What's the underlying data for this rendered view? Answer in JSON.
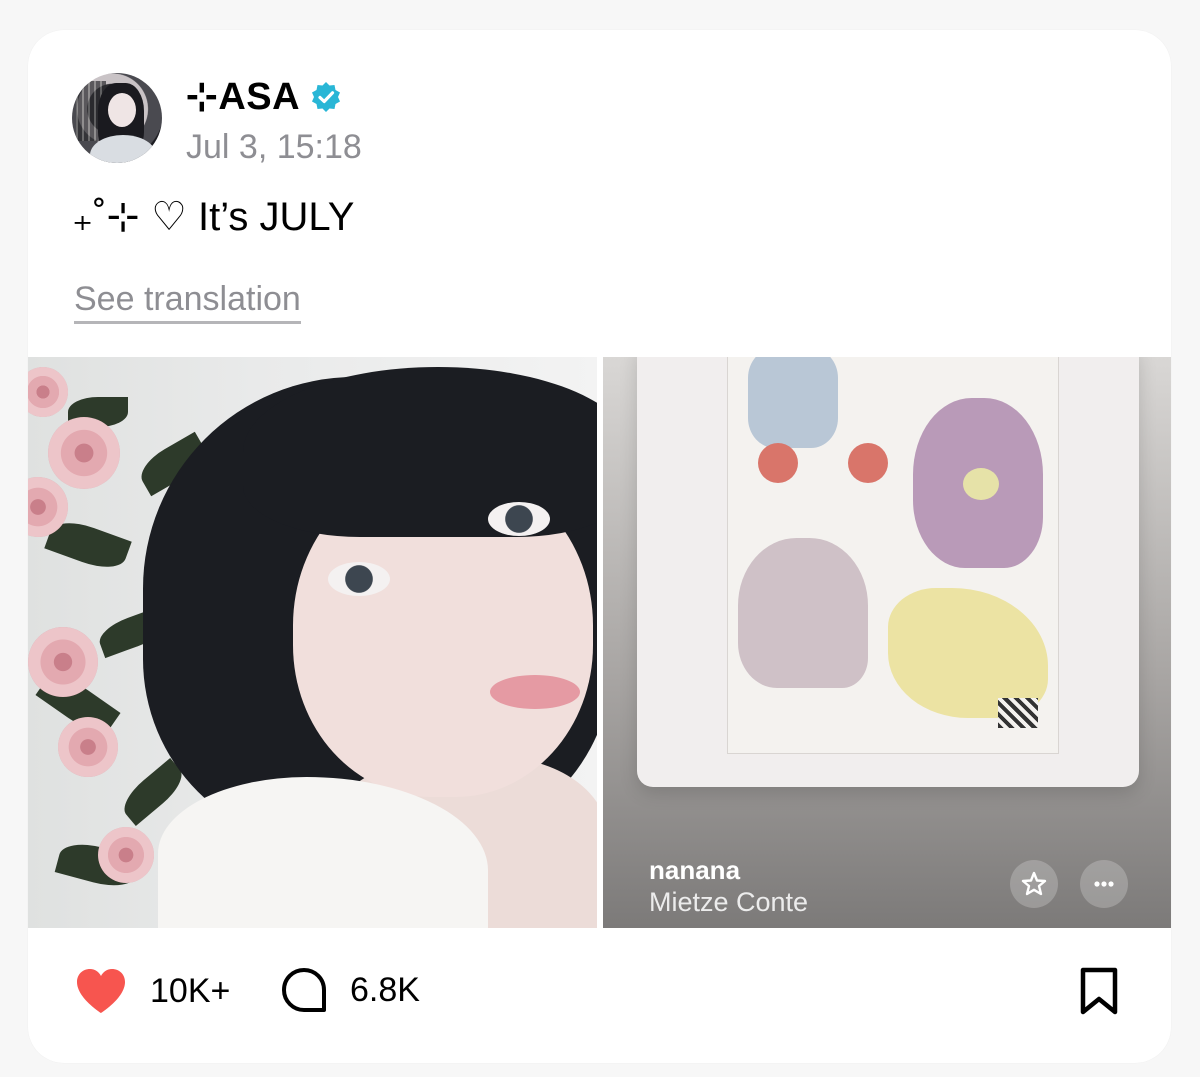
{
  "post": {
    "username": "⊹ASA",
    "timestamp": "Jul 3, 15:18",
    "text": "₊˚⊹ ♡ It’s JULY",
    "see_translation": "See translation"
  },
  "music": {
    "title": "nanana",
    "artist": "Mietze Conte"
  },
  "actions": {
    "likes": "10K+",
    "comments": "6.8K"
  },
  "colors": {
    "verified": "#29b6d6",
    "heart": "#f7554f",
    "secondary_text": "#8e8e93"
  },
  "icons": [
    "verified-icon",
    "heart-icon",
    "comment-icon",
    "bookmark-icon",
    "star-icon",
    "more-icon"
  ]
}
